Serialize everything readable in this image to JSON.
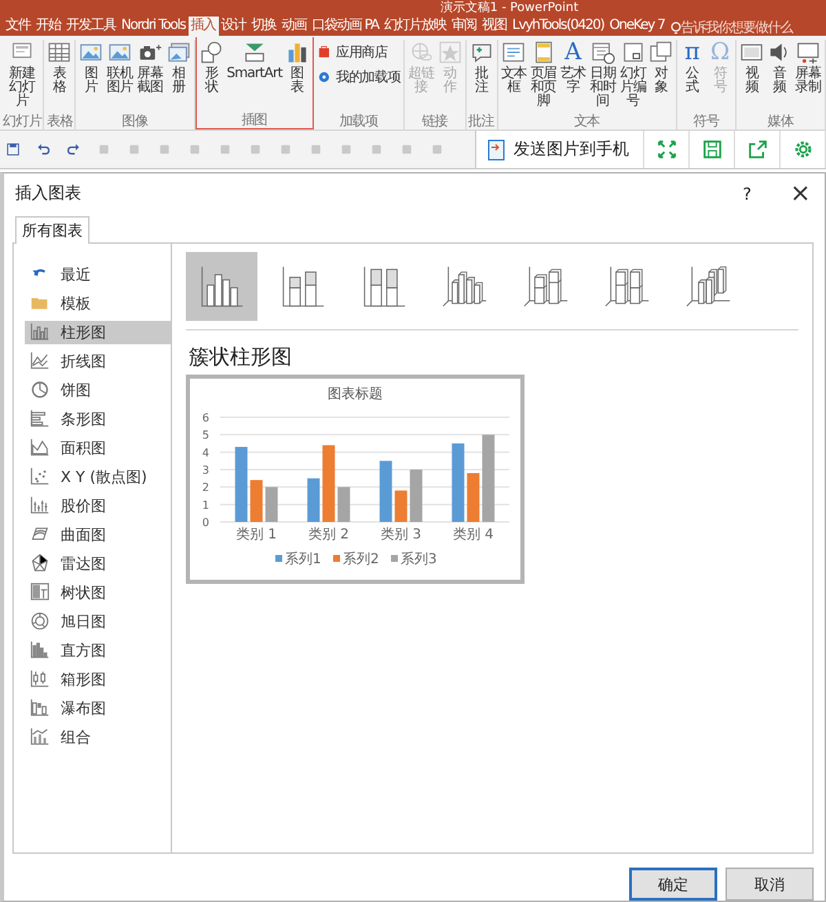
{
  "app": {
    "title": "演示文稿1 - PowerPoint"
  },
  "ribbon_tabs": [
    {
      "label": "文件",
      "selected": false
    },
    {
      "label": "开始",
      "selected": false
    },
    {
      "label": "开发工具",
      "selected": false
    },
    {
      "label": "Nordri Tools",
      "selected": false
    },
    {
      "label": "插入",
      "selected": true
    },
    {
      "label": "设计",
      "selected": false
    },
    {
      "label": "切换",
      "selected": false
    },
    {
      "label": "动画",
      "selected": false
    },
    {
      "label": "口袋动画 PA",
      "selected": false
    },
    {
      "label": "幻灯片放映",
      "selected": false
    },
    {
      "label": "审阅",
      "selected": false
    },
    {
      "label": "视图",
      "selected": false
    },
    {
      "label": "LvyhTools(0420)",
      "selected": false
    },
    {
      "label": "OneKey 7",
      "selected": false
    }
  ],
  "tell_me": {
    "placeholder": "告诉我你想要做什么"
  },
  "ribbon_groups": [
    {
      "label": "幻灯片",
      "highlighted": false,
      "items": [
        {
          "label": "新建幻灯片",
          "kind": "slide",
          "disabled": false
        }
      ]
    },
    {
      "label": "表格",
      "highlighted": false,
      "items": [
        {
          "label": "表格",
          "kind": "table",
          "disabled": false
        }
      ]
    },
    {
      "label": "图像",
      "highlighted": false,
      "items": [
        {
          "label": "图片",
          "kind": "picture",
          "disabled": false
        },
        {
          "label": "联机图片",
          "kind": "picture",
          "disabled": false
        },
        {
          "label": "屏幕截图",
          "kind": "screenshot",
          "disabled": false
        },
        {
          "label": "相册",
          "kind": "album",
          "disabled": false
        }
      ]
    },
    {
      "label": "插图",
      "highlighted": true,
      "items": [
        {
          "label": "形状",
          "kind": "shapes",
          "disabled": false
        },
        {
          "label": "SmartArt",
          "kind": "smartart",
          "disabled": false
        },
        {
          "label": "图表",
          "kind": "chart",
          "disabled": false
        }
      ]
    },
    {
      "label": "加载项",
      "highlighted": false,
      "items": [
        {
          "label": "应用商店",
          "kind": "store",
          "disabled": false
        },
        {
          "label": "我的加载项",
          "kind": "addin",
          "disabled": false
        }
      ]
    },
    {
      "label": "链接",
      "highlighted": false,
      "items": [
        {
          "label": "超链接",
          "kind": "link",
          "disabled": true
        },
        {
          "label": "动作",
          "kind": "action",
          "disabled": true
        }
      ]
    },
    {
      "label": "批注",
      "highlighted": false,
      "items": [
        {
          "label": "批注",
          "kind": "comment",
          "disabled": false
        }
      ]
    },
    {
      "label": "文本",
      "highlighted": false,
      "items": [
        {
          "label": "文本框",
          "kind": "textbox",
          "disabled": false
        },
        {
          "label": "页眉和页脚",
          "kind": "header",
          "disabled": false
        },
        {
          "label": "艺术字",
          "kind": "wordart",
          "glyph": "A",
          "disabled": false
        },
        {
          "label": "日期和时间",
          "kind": "date",
          "disabled": false
        },
        {
          "label": "幻灯片编号",
          "kind": "number",
          "disabled": false
        },
        {
          "label": "对象",
          "kind": "object",
          "disabled": false
        }
      ]
    },
    {
      "label": "符号",
      "highlighted": false,
      "items": [
        {
          "label": "公式",
          "kind": "formula",
          "glyph": "π",
          "disabled": false
        },
        {
          "label": "符号",
          "kind": "symbol",
          "glyph": "Ω",
          "disabled": true
        }
      ]
    },
    {
      "label": "媒体",
      "highlighted": false,
      "items": [
        {
          "label": "视频",
          "kind": "video",
          "disabled": false
        },
        {
          "label": "音频",
          "kind": "audio",
          "disabled": false
        },
        {
          "label": "屏幕录制",
          "kind": "record",
          "disabled": false
        }
      ]
    }
  ],
  "send_panel": {
    "button": "发送图片到手机"
  },
  "dialog": {
    "title": "插入图表",
    "help": "?",
    "close": "×",
    "tabs": [
      {
        "label": "所有图表",
        "selected": true
      }
    ],
    "chart_types": [
      {
        "label": "最近",
        "kind": "recent",
        "selected": false
      },
      {
        "label": "模板",
        "kind": "template",
        "selected": false
      },
      {
        "label": "柱形图",
        "kind": "column",
        "selected": true
      },
      {
        "label": "折线图",
        "kind": "line",
        "selected": false
      },
      {
        "label": "饼图",
        "kind": "pie",
        "selected": false
      },
      {
        "label": "条形图",
        "kind": "bar",
        "selected": false
      },
      {
        "label": "面积图",
        "kind": "area",
        "selected": false
      },
      {
        "label": "X Y (散点图)",
        "kind": "scatter",
        "selected": false
      },
      {
        "label": "股价图",
        "kind": "stock",
        "selected": false
      },
      {
        "label": "曲面图",
        "kind": "surface",
        "selected": false
      },
      {
        "label": "雷达图",
        "kind": "radar",
        "selected": false
      },
      {
        "label": "树状图",
        "kind": "treemap",
        "selected": false
      },
      {
        "label": "旭日图",
        "kind": "sunburst",
        "selected": false
      },
      {
        "label": "直方图",
        "kind": "histogram",
        "selected": false
      },
      {
        "label": "箱形图",
        "kind": "box",
        "selected": false
      },
      {
        "label": "瀑布图",
        "kind": "waterfall",
        "selected": false
      },
      {
        "label": "组合",
        "kind": "combo",
        "selected": false
      }
    ],
    "subtypes": [
      {
        "kind": "clustered",
        "selected": true
      },
      {
        "kind": "stacked",
        "selected": false
      },
      {
        "kind": "percent",
        "selected": false
      },
      {
        "kind": "clustered-3d",
        "selected": false
      },
      {
        "kind": "stacked-3d",
        "selected": false
      },
      {
        "kind": "percent-3d",
        "selected": false
      },
      {
        "kind": "column-3d",
        "selected": false
      }
    ],
    "subtype_title": "簇状柱形图",
    "preview": {
      "chart_data": {
        "type": "bar",
        "title": "图表标题",
        "categories": [
          "类别 1",
          "类别 2",
          "类别 3",
          "类别 4"
        ],
        "series": [
          {
            "name": "系列1",
            "color": "#5b9bd5",
            "values": [
              4.3,
              2.5,
              3.5,
              4.5
            ]
          },
          {
            "name": "系列2",
            "color": "#ed7d31",
            "values": [
              2.4,
              4.4,
              1.8,
              2.8
            ]
          },
          {
            "name": "系列3",
            "color": "#a5a5a5",
            "values": [
              2,
              2,
              3,
              5
            ]
          }
        ],
        "ylim": [
          0,
          6
        ],
        "yticks": [
          0,
          1,
          2,
          3,
          4,
          5,
          6
        ],
        "grid": true,
        "legend": true
      }
    },
    "buttons": [
      {
        "label": "确定",
        "kind": "primary"
      },
      {
        "label": "取消",
        "kind": "secondary"
      }
    ]
  }
}
